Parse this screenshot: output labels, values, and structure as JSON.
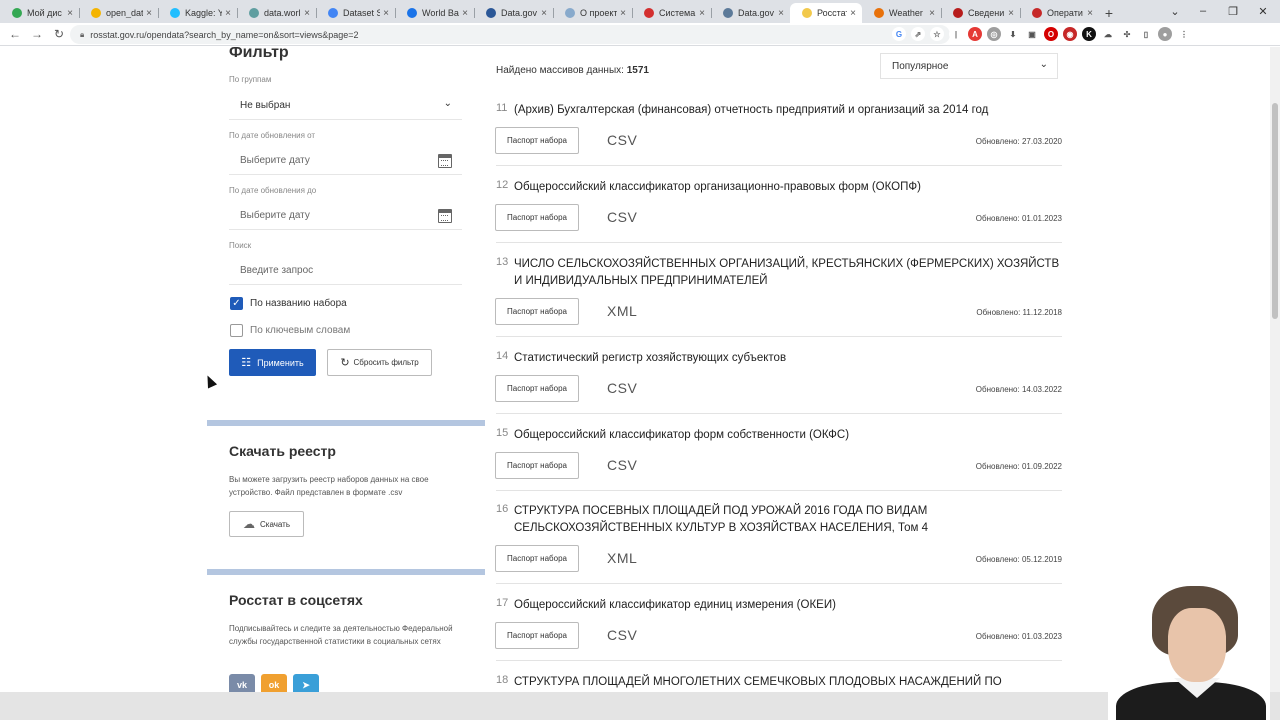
{
  "browser": {
    "tabs": [
      {
        "label": "Мой дис",
        "color": "#34a853"
      },
      {
        "label": "open_dat",
        "color": "#f4b400"
      },
      {
        "label": "Kaggle: Yo",
        "color": "#20beff"
      },
      {
        "label": "data.worl",
        "color": "#5f9ea0"
      },
      {
        "label": "Dataset S",
        "color": "#4285f4"
      },
      {
        "label": "World Ba",
        "color": "#1a73e8"
      },
      {
        "label": "Data.gov",
        "color": "#2b5797"
      },
      {
        "label": "О проект",
        "color": "#8ac"
      },
      {
        "label": "Система",
        "color": "#d32f2f"
      },
      {
        "label": "Data.gov",
        "color": "#5c7a99"
      },
      {
        "label": "Росстат -",
        "color": "#f2c94c",
        "active": true
      },
      {
        "label": "Weather",
        "color": "#e8710a"
      },
      {
        "label": "Сведени",
        "color": "#b71c1c"
      },
      {
        "label": "Операти",
        "color": "#c62828"
      }
    ],
    "url": "rosstat.gov.ru/opendata?search_by_name=on&sort=views&page=2"
  },
  "filter": {
    "title": "Фильтр",
    "group_label": "По группам",
    "group_value": "Не выбран",
    "date_from_label": "По дате обновления от",
    "date_from_placeholder": "Выберите дату",
    "date_to_label": "По дате обновления до",
    "date_to_placeholder": "Выберите дату",
    "search_label": "Поиск",
    "search_placeholder": "Введите запрос",
    "by_name_label": "По названию набора",
    "by_name_checked": true,
    "by_keywords_label": "По ключевым словам",
    "by_keywords_checked": false,
    "apply_label": "Применить",
    "reset_label": "Сбросить фильтр"
  },
  "registry": {
    "title": "Скачать реестр",
    "text": "Вы можете загрузить реестр наборов данных на свое устройство. Файл представлен в формате .csv",
    "download_label": "Скачать"
  },
  "social": {
    "title": "Росстат в соцсетях",
    "text": "Подписывайтесь и следите за деятельностью Федеральной службы государственной статистики в социальных сетях",
    "networks": [
      "vk-icon",
      "odnoklassniki-icon",
      "telegram-icon"
    ]
  },
  "results": {
    "found_label": "Найдено массивов данных:",
    "found_count": "1571",
    "sort_value": "Популярное",
    "passport_label": "Паспорт набора",
    "items": [
      {
        "num": "11",
        "title": "(Архив) Бухгалтерская (финансовая) отчетность предприятий и организаций за 2014 год",
        "format": "CSV",
        "updated": "Обновлено: 27.03.2020"
      },
      {
        "num": "12",
        "title": "Общероссийский классификатор организационно-правовых форм (ОКОПФ)",
        "format": "CSV",
        "updated": "Обновлено: 01.01.2023"
      },
      {
        "num": "13",
        "title": "ЧИСЛО СЕЛЬСКОХОЗЯЙСТВЕННЫХ ОРГАНИЗАЦИЙ, КРЕСТЬЯНСКИХ (ФЕРМЕРСКИХ) ХОЗЯЙСТВ И ИНДИВИДУАЛЬНЫХ ПРЕДПРИНИМАТЕЛЕЙ",
        "format": "XML",
        "updated": "Обновлено: 11.12.2018"
      },
      {
        "num": "14",
        "title": "Статистический регистр хозяйствующих субъектов",
        "format": "CSV",
        "updated": "Обновлено: 14.03.2022"
      },
      {
        "num": "15",
        "title": "Общероссийский классификатор форм собственности (ОКФС)",
        "format": "CSV",
        "updated": "Обновлено: 01.09.2022"
      },
      {
        "num": "16",
        "title": "СТРУКТУРА ПОСЕВНЫХ ПЛОЩАДЕЙ ПОД УРОЖАЙ 2016 ГОДА ПО ВИДАМ СЕЛЬСКОХОЗЯЙСТВЕННЫХ КУЛЬТУР В ХОЗЯЙСТВАХ НАСЕЛЕНИЯ, Том 4",
        "format": "XML",
        "updated": "Обновлено: 05.12.2019"
      },
      {
        "num": "17",
        "title": "Общероссийский классификатор единиц измерения (ОКЕИ)",
        "format": "CSV",
        "updated": "Обновлено: 01.03.2023"
      },
      {
        "num": "18",
        "title": "СТРУКТУРА ПЛОЩАДЕЙ МНОГОЛЕТНИХ СЕМЕЧКОВЫХ ПЛОДОВЫХ НАСАЖДЕНИЙ ПО",
        "format": "",
        "updated": ""
      }
    ]
  },
  "colors": {
    "accent": "#1f5bb9",
    "divider": "#b4c6e0"
  }
}
